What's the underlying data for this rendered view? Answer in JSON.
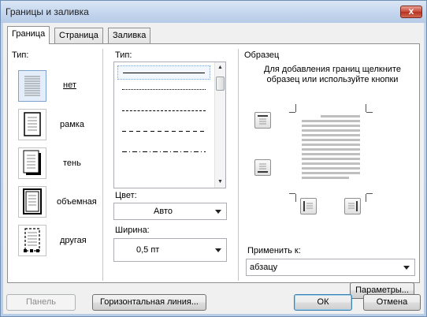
{
  "window": {
    "title": "Границы и заливка",
    "close_glyph": "x"
  },
  "tabs": [
    {
      "label": "Граница",
      "active": true,
      "mnemonic_index": 0
    },
    {
      "label": "Страница",
      "active": false
    },
    {
      "label": "Заливка",
      "active": false
    }
  ],
  "type_section": {
    "label": "Тип:",
    "options": [
      {
        "label": "нет",
        "icon": "border-none-icon",
        "selected": true
      },
      {
        "label": "рамка",
        "icon": "border-box-icon",
        "selected": false
      },
      {
        "label": "тень",
        "icon": "border-shadow-icon",
        "selected": false
      },
      {
        "label": "объемная",
        "icon": "border-3d-icon",
        "selected": false
      },
      {
        "label": "другая",
        "icon": "border-custom-icon",
        "selected": false
      }
    ]
  },
  "style_section": {
    "label": "Тип:",
    "line_styles": [
      "solid",
      "dotted",
      "dashed-small",
      "dashed",
      "dash-dot"
    ],
    "color_label": "Цвет:",
    "color_value": "Авто",
    "width_label": "Ширина:",
    "width_value": "0,5 пт"
  },
  "preview_section": {
    "label": "Образец",
    "hint": "Для добавления границ щелкните образец или используйте кнопки",
    "apply_to_label": "Применить к:",
    "apply_to_value": "абзацу",
    "params_button": "Параметры..."
  },
  "footer": {
    "panel_button": "Панель",
    "hline_button": "Горизонтальная линия...",
    "ok_button": "ОК",
    "cancel_button": "Отмена"
  },
  "colors": {
    "accent": "#3c7fb1",
    "close": "#c7493a",
    "selection": "#e4eefb"
  }
}
